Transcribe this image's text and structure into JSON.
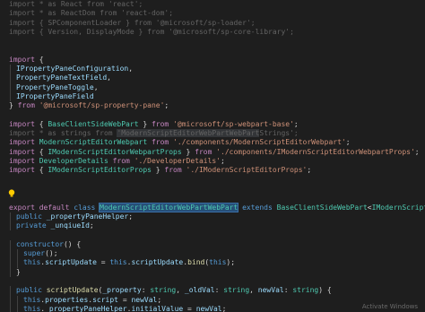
{
  "editor": {
    "lines": [
      {
        "indent": 0,
        "tokens": [
          {
            "t": "import ",
            "c": "ctrl",
            "d": true
          },
          {
            "t": "* ",
            "c": "punc",
            "d": true
          },
          {
            "t": "as ",
            "c": "ctrl",
            "d": true
          },
          {
            "t": "React ",
            "c": "var",
            "d": true
          },
          {
            "t": "from ",
            "c": "ctrl",
            "d": true
          },
          {
            "t": "'react'",
            "c": "str",
            "d": true
          },
          {
            "t": ";",
            "c": "punc",
            "d": true
          }
        ]
      },
      {
        "indent": 0,
        "tokens": [
          {
            "t": "import ",
            "c": "ctrl",
            "d": true
          },
          {
            "t": "* ",
            "c": "punc",
            "d": true
          },
          {
            "t": "as ",
            "c": "ctrl",
            "d": true
          },
          {
            "t": "ReactDom ",
            "c": "var",
            "d": true
          },
          {
            "t": "from ",
            "c": "ctrl",
            "d": true
          },
          {
            "t": "'react-dom'",
            "c": "str",
            "d": true
          },
          {
            "t": ";",
            "c": "punc",
            "d": true
          }
        ]
      },
      {
        "indent": 0,
        "tokens": [
          {
            "t": "import ",
            "c": "ctrl",
            "d": true
          },
          {
            "t": "{ ",
            "c": "punc",
            "d": true
          },
          {
            "t": "SPComponentLoader ",
            "c": "var",
            "d": true
          },
          {
            "t": "} ",
            "c": "punc",
            "d": true
          },
          {
            "t": "from ",
            "c": "ctrl",
            "d": true
          },
          {
            "t": "'@microsoft/sp-loader'",
            "c": "str",
            "d": true
          },
          {
            "t": ";",
            "c": "punc",
            "d": true
          }
        ]
      },
      {
        "indent": 0,
        "tokens": [
          {
            "t": "import ",
            "c": "ctrl",
            "d": true
          },
          {
            "t": "{ ",
            "c": "punc",
            "d": true
          },
          {
            "t": "Version",
            "c": "var",
            "d": true
          },
          {
            "t": ", ",
            "c": "punc",
            "d": true
          },
          {
            "t": "DisplayMode ",
            "c": "var",
            "d": true
          },
          {
            "t": "} ",
            "c": "punc",
            "d": true
          },
          {
            "t": "from ",
            "c": "ctrl",
            "d": true
          },
          {
            "t": "'@microsoft/sp-core-library'",
            "c": "str",
            "d": true
          },
          {
            "t": ";",
            "c": "punc",
            "d": true
          }
        ]
      },
      {
        "indent": 0,
        "tokens": []
      },
      {
        "indent": 0,
        "tokens": []
      },
      {
        "indent": 0,
        "tokens": [
          {
            "t": "import ",
            "c": "ctrl"
          },
          {
            "t": "{",
            "c": "punc"
          }
        ]
      },
      {
        "indent": 1,
        "tokens": [
          {
            "t": "IPropertyPaneConfiguration",
            "c": "var"
          },
          {
            "t": ",",
            "c": "punc"
          }
        ]
      },
      {
        "indent": 1,
        "tokens": [
          {
            "t": "PropertyPaneTextField",
            "c": "var"
          },
          {
            "t": ",",
            "c": "punc"
          }
        ]
      },
      {
        "indent": 1,
        "tokens": [
          {
            "t": "PropertyPaneToggle",
            "c": "var"
          },
          {
            "t": ",",
            "c": "punc"
          }
        ]
      },
      {
        "indent": 1,
        "tokens": [
          {
            "t": "IPropertyPaneField",
            "c": "var"
          }
        ]
      },
      {
        "indent": 0,
        "tokens": [
          {
            "t": "} ",
            "c": "punc"
          },
          {
            "t": "from ",
            "c": "ctrl"
          },
          {
            "t": "'@microsoft/sp-property-pane'",
            "c": "str"
          },
          {
            "t": ";",
            "c": "punc"
          }
        ]
      },
      {
        "indent": 0,
        "tokens": []
      },
      {
        "indent": 0,
        "tokens": [
          {
            "t": "import ",
            "c": "ctrl"
          },
          {
            "t": "{ ",
            "c": "punc"
          },
          {
            "t": "BaseClientSideWebPart ",
            "c": "type"
          },
          {
            "t": "} ",
            "c": "punc"
          },
          {
            "t": "from ",
            "c": "ctrl"
          },
          {
            "t": "'@microsoft/sp-webpart-base'",
            "c": "str"
          },
          {
            "t": ";",
            "c": "punc"
          }
        ]
      },
      {
        "indent": 0,
        "tokens": [
          {
            "t": "import ",
            "c": "ctrl",
            "d": true
          },
          {
            "t": "* ",
            "c": "punc",
            "d": true
          },
          {
            "t": "as ",
            "c": "ctrl",
            "d": true
          },
          {
            "t": "strings ",
            "c": "var",
            "d": true
          },
          {
            "t": "from ",
            "c": "ctrl",
            "d": true
          },
          {
            "t": "'ModernScriptEditorWebPartWebPart",
            "c": "str",
            "d": true,
            "hl": "word"
          },
          {
            "t": "Strings'",
            "c": "str",
            "d": true
          },
          {
            "t": ";",
            "c": "punc",
            "d": true
          }
        ]
      },
      {
        "indent": 0,
        "tokens": [
          {
            "t": "import ",
            "c": "ctrl"
          },
          {
            "t": "ModernScriptEditorWebpart ",
            "c": "type"
          },
          {
            "t": "from ",
            "c": "ctrl"
          },
          {
            "t": "'./components/ModernScriptEditorWebpart'",
            "c": "str"
          },
          {
            "t": ";",
            "c": "punc"
          }
        ]
      },
      {
        "indent": 0,
        "tokens": [
          {
            "t": "import ",
            "c": "ctrl"
          },
          {
            "t": "{ ",
            "c": "punc"
          },
          {
            "t": "IModernScriptEditorWebpartProps ",
            "c": "type"
          },
          {
            "t": "} ",
            "c": "punc"
          },
          {
            "t": "from ",
            "c": "ctrl"
          },
          {
            "t": "'./components/IModernScriptEditorWebpartProps'",
            "c": "str"
          },
          {
            "t": ";",
            "c": "punc"
          }
        ]
      },
      {
        "indent": 0,
        "tokens": [
          {
            "t": "import ",
            "c": "ctrl"
          },
          {
            "t": "DeveloperDetails ",
            "c": "type"
          },
          {
            "t": "from ",
            "c": "ctrl"
          },
          {
            "t": "'./DeveloperDetails'",
            "c": "str"
          },
          {
            "t": ";",
            "c": "punc"
          }
        ]
      },
      {
        "indent": 0,
        "tokens": [
          {
            "t": "import ",
            "c": "ctrl"
          },
          {
            "t": "{ ",
            "c": "punc"
          },
          {
            "t": "IModernScriptEditorProps ",
            "c": "type"
          },
          {
            "t": "} ",
            "c": "punc"
          },
          {
            "t": "from ",
            "c": "ctrl"
          },
          {
            "t": "'./IModernScriptEditorProps'",
            "c": "str"
          },
          {
            "t": ";",
            "c": "punc"
          }
        ]
      },
      {
        "indent": 0,
        "tokens": []
      },
      {
        "indent": 0,
        "tokens": []
      },
      {
        "indent": 0,
        "tokens": []
      },
      {
        "indent": 0,
        "tokens": [
          {
            "t": "export ",
            "c": "ctrl"
          },
          {
            "t": "default ",
            "c": "ctrl"
          },
          {
            "t": "class ",
            "c": "kw"
          },
          {
            "t": "ModernScriptEditorWebPartWebPart",
            "c": "type",
            "hl": "sel"
          },
          {
            "t": " extends ",
            "c": "kw"
          },
          {
            "t": "BaseClientSideWebPart",
            "c": "type"
          },
          {
            "t": "<",
            "c": "punc"
          },
          {
            "t": "IModernScriptEditorProps",
            "c": "type"
          },
          {
            "t": "> ",
            "c": "punc"
          },
          {
            "t": "{",
            "c": "bracket"
          }
        ]
      },
      {
        "indent": 1,
        "tokens": [
          {
            "t": "public ",
            "c": "kw"
          },
          {
            "t": "_propertyPaneHelper",
            "c": "var"
          },
          {
            "t": ";",
            "c": "punc"
          }
        ]
      },
      {
        "indent": 1,
        "tokens": [
          {
            "t": "private ",
            "c": "kw"
          },
          {
            "t": "_unqiueId",
            "c": "var"
          },
          {
            "t": ";",
            "c": "punc"
          }
        ]
      },
      {
        "indent": 0,
        "tokens": []
      },
      {
        "indent": 1,
        "tokens": [
          {
            "t": "constructor",
            "c": "kw"
          },
          {
            "t": "() {",
            "c": "punc"
          }
        ]
      },
      {
        "indent": 2,
        "tokens": [
          {
            "t": "super",
            "c": "kw"
          },
          {
            "t": "();",
            "c": "punc"
          }
        ]
      },
      {
        "indent": 2,
        "tokens": [
          {
            "t": "this",
            "c": "kw"
          },
          {
            "t": ".",
            "c": "punc"
          },
          {
            "t": "scriptUpdate",
            "c": "var"
          },
          {
            "t": " = ",
            "c": "punc"
          },
          {
            "t": "this",
            "c": "kw"
          },
          {
            "t": ".",
            "c": "punc"
          },
          {
            "t": "scriptUpdate",
            "c": "var"
          },
          {
            "t": ".",
            "c": "punc"
          },
          {
            "t": "bind",
            "c": "fn"
          },
          {
            "t": "(",
            "c": "punc"
          },
          {
            "t": "this",
            "c": "kw"
          },
          {
            "t": ");",
            "c": "punc"
          }
        ]
      },
      {
        "indent": 1,
        "tokens": [
          {
            "t": "}",
            "c": "punc"
          }
        ]
      },
      {
        "indent": 0,
        "tokens": []
      },
      {
        "indent": 1,
        "tokens": [
          {
            "t": "public ",
            "c": "kw"
          },
          {
            "t": "scriptUpdate",
            "c": "fn"
          },
          {
            "t": "(",
            "c": "punc"
          },
          {
            "t": "_property",
            "c": "var"
          },
          {
            "t": ": ",
            "c": "punc"
          },
          {
            "t": "string",
            "c": "type"
          },
          {
            "t": ", ",
            "c": "punc"
          },
          {
            "t": "_oldVal",
            "c": "var"
          },
          {
            "t": ": ",
            "c": "punc"
          },
          {
            "t": "string",
            "c": "type"
          },
          {
            "t": ", ",
            "c": "punc"
          },
          {
            "t": "newVal",
            "c": "var"
          },
          {
            "t": ": ",
            "c": "punc"
          },
          {
            "t": "string",
            "c": "type"
          },
          {
            "t": ") {",
            "c": "punc"
          }
        ]
      },
      {
        "indent": 2,
        "tokens": [
          {
            "t": "this",
            "c": "kw"
          },
          {
            "t": ".",
            "c": "punc"
          },
          {
            "t": "properties",
            "c": "var"
          },
          {
            "t": ".",
            "c": "punc"
          },
          {
            "t": "script",
            "c": "var"
          },
          {
            "t": " = ",
            "c": "punc"
          },
          {
            "t": "newVal",
            "c": "var"
          },
          {
            "t": ";",
            "c": "punc"
          }
        ]
      },
      {
        "indent": 2,
        "tokens": [
          {
            "t": "this",
            "c": "kw"
          },
          {
            "t": ".",
            "c": "punc"
          },
          {
            "t": "_propertyPaneHelper",
            "c": "var"
          },
          {
            "t": ".",
            "c": "punc"
          },
          {
            "t": "initialValue",
            "c": "var"
          },
          {
            "t": " = ",
            "c": "punc"
          },
          {
            "t": "newVal",
            "c": "var"
          },
          {
            "t": ";",
            "c": "punc"
          }
        ]
      }
    ]
  },
  "lightbulb": {
    "icon": "lightbulb-icon",
    "color": "#ffcc00"
  },
  "status_hint": "Activate Windows"
}
